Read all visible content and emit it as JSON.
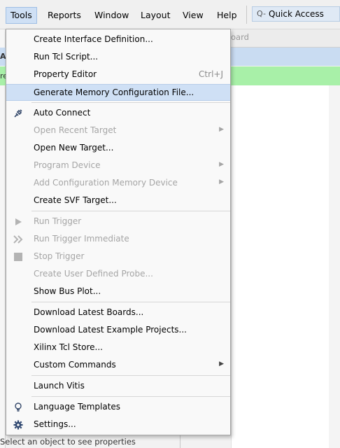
{
  "menubar": {
    "items": [
      {
        "label": "Tools",
        "active": true
      },
      {
        "label": "Reports"
      },
      {
        "label": "Window"
      },
      {
        "label": "Layout"
      },
      {
        "label": "View"
      },
      {
        "label": "Help"
      }
    ],
    "quick_access": {
      "placeholder": "Quick Access",
      "icon": "search-icon"
    }
  },
  "background": {
    "tab_fragment": "oard",
    "left_fragment_1": "A",
    "left_fragment_2": "re",
    "bottom_status": "Select an object to see properties"
  },
  "menu": {
    "items": [
      {
        "label": "Create Interface Definition...",
        "enabled": true
      },
      {
        "label": "Run Tcl Script...",
        "enabled": true
      },
      {
        "label": "Property Editor",
        "shortcut": "Ctrl+J",
        "enabled": true
      },
      {
        "label": "Generate Memory Configuration File...",
        "enabled": true,
        "highlighted": true
      },
      {
        "label": "Auto Connect",
        "icon": "auto-connect-icon",
        "enabled": true
      },
      {
        "label": "Open Recent Target",
        "submenu": true,
        "enabled": false
      },
      {
        "label": "Open New Target...",
        "enabled": true
      },
      {
        "label": "Program Device",
        "submenu": true,
        "enabled": false
      },
      {
        "label": "Add Configuration Memory Device",
        "submenu": true,
        "enabled": false
      },
      {
        "label": "Create SVF Target...",
        "enabled": true
      },
      {
        "label": "Run Trigger",
        "icon": "play-icon",
        "enabled": false
      },
      {
        "label": "Run Trigger Immediate",
        "icon": "fast-forward-icon",
        "enabled": false
      },
      {
        "label": "Stop Trigger",
        "icon": "stop-icon",
        "enabled": false
      },
      {
        "label": "Create User Defined Probe...",
        "enabled": false
      },
      {
        "label": "Show Bus Plot...",
        "enabled": true
      },
      {
        "label": "Download Latest Boards...",
        "enabled": true
      },
      {
        "label": "Download Latest Example Projects...",
        "enabled": true
      },
      {
        "label": "Xilinx Tcl Store...",
        "enabled": true
      },
      {
        "label": "Custom Commands",
        "submenu": true,
        "enabled": true
      },
      {
        "label": "Launch Vitis",
        "enabled": true
      },
      {
        "label": "Language Templates",
        "icon": "lightbulb-icon",
        "enabled": true
      },
      {
        "label": "Settings...",
        "icon": "gear-icon",
        "enabled": true
      }
    ]
  }
}
